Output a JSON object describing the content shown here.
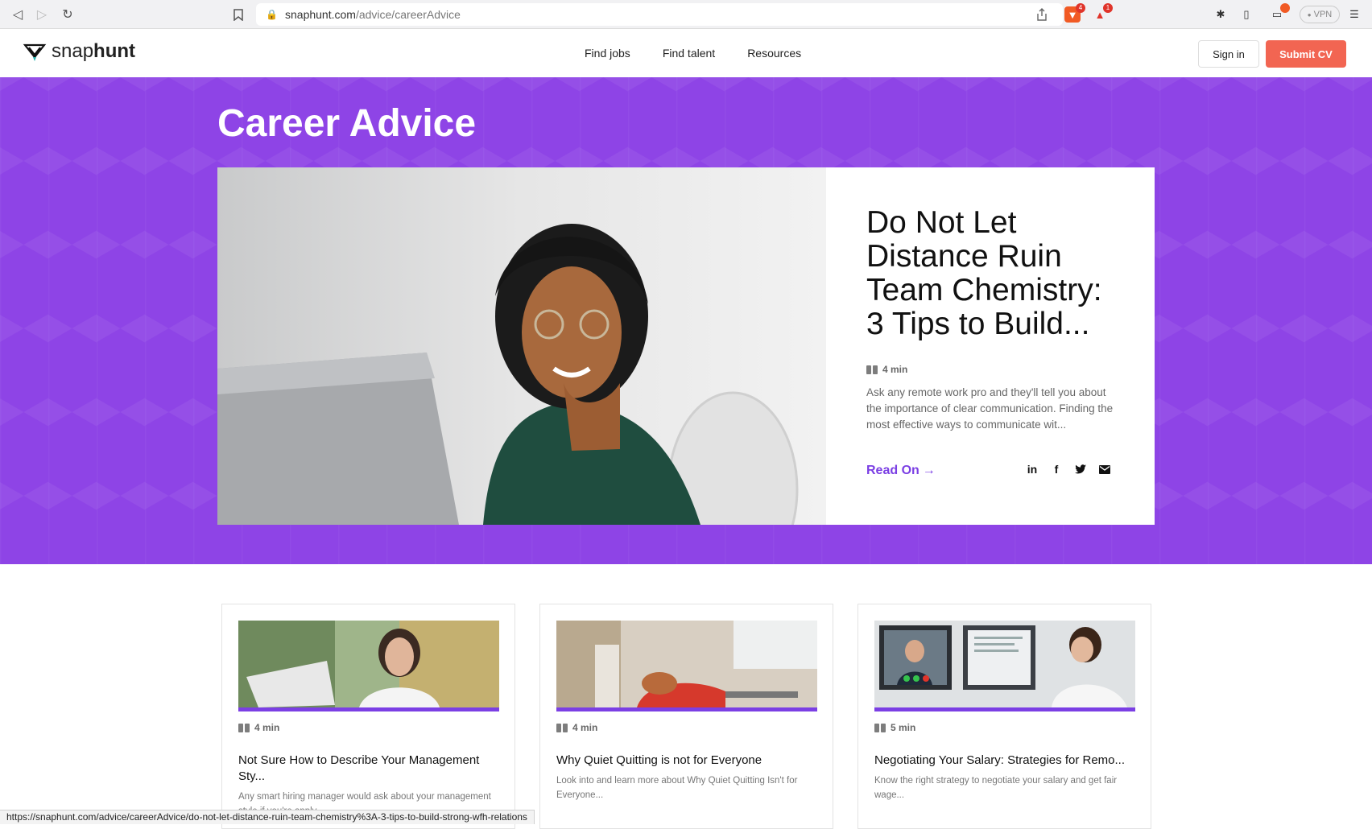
{
  "browser": {
    "url_domain": "snaphunt.com",
    "url_path": "/advice/careerAdvice",
    "vpn_label": "VPN",
    "brave_badge": "4",
    "alert_badge": "1"
  },
  "header": {
    "logo_light": "snap",
    "logo_bold": "hunt",
    "nav": [
      "Find jobs",
      "Find talent",
      "Resources"
    ],
    "signin_label": "Sign in",
    "submit_label": "Submit CV",
    "accent_color": "#8e44e6",
    "submit_color": "#f26552"
  },
  "hero": {
    "title": "Career Advice",
    "feature": {
      "headline": "Do Not Let Distance Ruin Team Chemistry: 3 Tips to Build...",
      "read_time": "4 min",
      "excerpt": "Ask any remote work pro and they'll tell you about the importance of clear communication. Finding the most effective ways to communicate wit...",
      "read_on": "Read On",
      "share_icons": [
        "linkedin-icon",
        "facebook-icon",
        "twitter-icon",
        "email-icon"
      ]
    }
  },
  "cards": [
    {
      "read_time": "4 min",
      "title": "Not Sure How to Describe Your Management Sty...",
      "excerpt": "Any smart hiring manager would ask about your management style if you're apply..."
    },
    {
      "read_time": "4 min",
      "title": "Why Quiet Quitting is not for Everyone",
      "excerpt": "Look into and learn more about Why Quiet Quitting Isn't for Everyone..."
    },
    {
      "read_time": "5 min",
      "title": "Negotiating Your Salary: Strategies for Remo...",
      "excerpt": "Know the right strategy to negotiate your salary and get fair wage..."
    }
  ],
  "status_url": "https://snaphunt.com/advice/careerAdvice/do-not-let-distance-ruin-team-chemistry%3A-3-tips-to-build-strong-wfh-relations"
}
